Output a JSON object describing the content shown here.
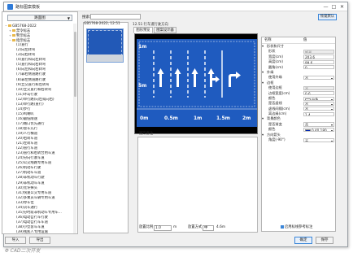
{
  "window": {
    "title": "路标图案模板",
    "controls": [
      "—",
      "□",
      "✕"
    ]
  },
  "left": {
    "dropdown_value": "路面图",
    "tree_items": [
      {
        "label": "GB5768-2022",
        "level": 0,
        "expander": "−"
      },
      {
        "label": "禁令标志",
        "level": 1,
        "expander": "+"
      },
      {
        "label": "警示标志",
        "level": 1,
        "expander": "+"
      },
      {
        "label": "指示标志",
        "level": 1,
        "expander": "−"
      },
      {
        "label": "(1)直行",
        "level": 2
      },
      {
        "label": "(2)向左转弯",
        "level": 2
      },
      {
        "label": "(3)向右转弯",
        "level": 2
      },
      {
        "label": "(4)直行和向左转弯",
        "level": 2
      },
      {
        "label": "(5)直行和向右转弯",
        "level": 2
      },
      {
        "label": "(6)向左和向右转弯",
        "level": 2
      },
      {
        "label": "(7)靠右侧道路行驶",
        "level": 2
      },
      {
        "label": "(8)靠左侧道路行驶",
        "level": 2
      },
      {
        "label": "(9)立交直行和左转弯",
        "level": 2
      },
      {
        "label": "(10)立交直行和右转弯",
        "level": 2
      },
      {
        "label": "(11)环岛行驶",
        "level": 2
      },
      {
        "label": "(12)单行路(向左或向右)",
        "level": 2
      },
      {
        "label": "(13)单行路(直行)",
        "level": 2
      },
      {
        "label": "(14)步行",
        "level": 2
      },
      {
        "label": "(15)鸣喇叭",
        "level": 2
      },
      {
        "label": "(16)最低限速",
        "level": 2
      },
      {
        "label": "(17)路口优先通行",
        "level": 2
      },
      {
        "label": "(18)会车先行",
        "level": 2
      },
      {
        "label": "(19)人行横道",
        "level": 2
      },
      {
        "label": "(20)右转车道",
        "level": 2
      },
      {
        "label": "(21)左转车道",
        "level": 2
      },
      {
        "label": "(22)直行车道",
        "level": 2
      },
      {
        "label": "(23)直行和右转合用车道",
        "level": 2
      },
      {
        "label": "(24)分向行驶车道",
        "level": 2
      },
      {
        "label": "(25)公交线路专用车道",
        "level": 2
      },
      {
        "label": "(26)机动车行驶",
        "level": 2
      },
      {
        "label": "(27)机动车车道",
        "level": 2
      },
      {
        "label": "(28)非机动车行驶",
        "level": 2
      },
      {
        "label": "(29)非机动车车道",
        "level": 2
      },
      {
        "label": "(30)允许掉头",
        "level": 2
      },
      {
        "label": "(31)快速公交专用车道",
        "level": 2
      },
      {
        "label": "(32)多乘员车辆专用车道",
        "level": 2
      },
      {
        "label": "(33)停车位",
        "level": 2
      },
      {
        "label": "(34)货车通行",
        "level": 2
      },
      {
        "label": "(35)分时段非机动车专用车...",
        "level": 2
      },
      {
        "label": "(36)电动自行车行驶",
        "level": 2
      },
      {
        "label": "(37)电动自行车车道",
        "level": 2
      },
      {
        "label": "(38)小型客车车道",
        "level": 2
      },
      {
        "label": "(39)残疾人专用设施",
        "level": 2
      },
      {
        "label": "(40)快速路",
        "level": 2
      },
      {
        "label": "(41)紧急停车带",
        "level": 2
      },
      {
        "label": "(42)车道行驶方向",
        "level": 2
      },
      {
        "label": "(43)靠右行驶",
        "level": 2
      }
    ],
    "import_label": "导入",
    "export_label": "导出"
  },
  "search": {
    "label": "搜索:",
    "value": ""
  },
  "thumbnails": {
    "caption": "GB5768-2022, 12.51"
  },
  "main": {
    "caption": "12.51 行车道行驶方向",
    "tabs": [
      "图形预览",
      "图案设计器"
    ],
    "ruler_x": [
      "0m",
      "0.5m",
      "1m",
      "1.5m",
      "2m"
    ],
    "ruler_y": [
      "1m",
      "5m"
    ],
    "remark_label": "图案备注"
  },
  "properties": {
    "reset_label": "恢复默认",
    "header_name": "名称",
    "header_value": "值",
    "rows": [
      {
        "name": "形状和尺寸",
        "value": null,
        "category": true
      },
      {
        "name": "形状",
        "value": "矩形",
        "readonly": true
      },
      {
        "name": "宽度(cm)",
        "value": "203.6"
      },
      {
        "name": "高度(cm)",
        "value": "99.6"
      },
      {
        "name": "圆角(cm)",
        "value": "0"
      },
      {
        "name": "外缘",
        "value": null,
        "category": true
      },
      {
        "name": "使用外缘",
        "value": "否",
        "dropdown": true
      },
      {
        "name": "边框",
        "value": null,
        "category": true
      },
      {
        "name": "使用边框",
        "value": "否",
        "readonly": true
      },
      {
        "name": "边框宽度(cm)",
        "value": "0.6"
      },
      {
        "name": "颜色",
        "value": "白色",
        "dropdown": true,
        "swatch": "#ffffff"
      },
      {
        "name": "是否虚线",
        "value": "否",
        "dropdown": true
      },
      {
        "name": "虚线间隔(cm)",
        "value": "否",
        "dropdown": true
      },
      {
        "name": "离边缘(cm)",
        "value": "1.4"
      },
      {
        "name": "背景颜色",
        "value": null,
        "category": true
      },
      {
        "name": "是否渐变",
        "value": "否",
        "dropdown": true
      },
      {
        "name": "颜色",
        "value": "0,40,180",
        "dropdown": true,
        "swatch": "#0028b4"
      },
      {
        "name": "方向箭头",
        "value": null,
        "category": true
      },
      {
        "name": "角度(-90°)",
        "value": "无",
        "dropdown": true
      }
    ]
  },
  "bottom": {
    "scale_label": "放置比例",
    "scale_value": "1.0",
    "unit_label": "m",
    "placement_label": "放置方式",
    "placement_value": "中",
    "size_value": "4.6m",
    "checkbox_label": "启用标线参考标注",
    "checkbox_checked": true,
    "ok_label": "确定",
    "cancel_label": "取消",
    "apply_label": "保存"
  },
  "watermark": "Φ CAD二次开发",
  "colors": {
    "sign_blue": "#1f5bbf",
    "accent": "#3b86d8"
  }
}
